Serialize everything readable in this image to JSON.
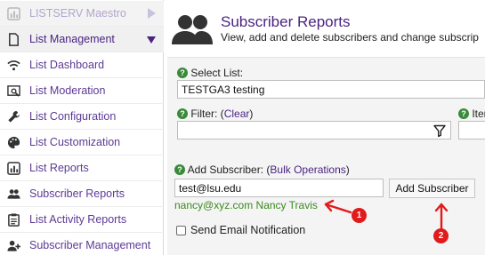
{
  "sidebar": {
    "items": [
      {
        "label": "LISTSERV Maestro"
      },
      {
        "label": "List Management"
      },
      {
        "label": "List Dashboard"
      },
      {
        "label": "List Moderation"
      },
      {
        "label": "List Configuration"
      },
      {
        "label": "List Customization"
      },
      {
        "label": "List Reports"
      },
      {
        "label": "Subscriber Reports"
      },
      {
        "label": "List Activity Reports"
      },
      {
        "label": "Subscriber Management"
      }
    ]
  },
  "header": {
    "title": "Subscriber Reports",
    "subtitle": "View, add and delete subscribers and change subscrip"
  },
  "form": {
    "help_glyph": "?",
    "select_list_label": "Select List:",
    "select_list_value": "TESTGA3 testing",
    "filter_label": "Filter: (",
    "filter_link": "Clear",
    "filter_label_end": ")",
    "items_label": "Iten",
    "add_subscriber_label": "Add Subscriber: (",
    "bulk_link": "Bulk Operations",
    "add_subscriber_label_end": ")",
    "add_subscriber_value": "test@lsu.edu",
    "add_button": "Add Subscriber",
    "suggestion": "nancy@xyz.com Nancy Travis",
    "send_email_label": "Send Email Notification"
  },
  "annotations": [
    {
      "number": "1"
    },
    {
      "number": "2"
    }
  ],
  "colors": {
    "brand_purple": "#4a2483",
    "help_green": "#3a8a3a",
    "annotation_red": "#e11b1b"
  }
}
